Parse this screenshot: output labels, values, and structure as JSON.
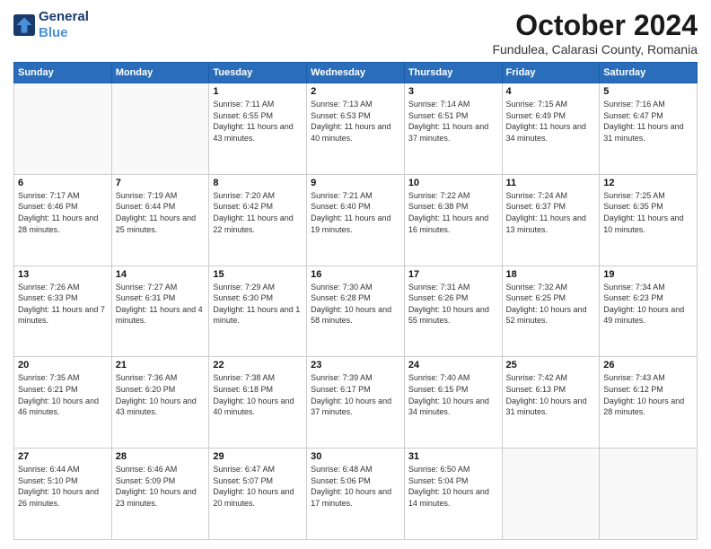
{
  "header": {
    "logo_line1": "General",
    "logo_line2": "Blue",
    "month_title": "October 2024",
    "location": "Fundulea, Calarasi County, Romania"
  },
  "days_of_week": [
    "Sunday",
    "Monday",
    "Tuesday",
    "Wednesday",
    "Thursday",
    "Friday",
    "Saturday"
  ],
  "weeks": [
    [
      {
        "day": "",
        "info": ""
      },
      {
        "day": "",
        "info": ""
      },
      {
        "day": "1",
        "info": "Sunrise: 7:11 AM\nSunset: 6:55 PM\nDaylight: 11 hours and 43 minutes."
      },
      {
        "day": "2",
        "info": "Sunrise: 7:13 AM\nSunset: 6:53 PM\nDaylight: 11 hours and 40 minutes."
      },
      {
        "day": "3",
        "info": "Sunrise: 7:14 AM\nSunset: 6:51 PM\nDaylight: 11 hours and 37 minutes."
      },
      {
        "day": "4",
        "info": "Sunrise: 7:15 AM\nSunset: 6:49 PM\nDaylight: 11 hours and 34 minutes."
      },
      {
        "day": "5",
        "info": "Sunrise: 7:16 AM\nSunset: 6:47 PM\nDaylight: 11 hours and 31 minutes."
      }
    ],
    [
      {
        "day": "6",
        "info": "Sunrise: 7:17 AM\nSunset: 6:46 PM\nDaylight: 11 hours and 28 minutes."
      },
      {
        "day": "7",
        "info": "Sunrise: 7:19 AM\nSunset: 6:44 PM\nDaylight: 11 hours and 25 minutes."
      },
      {
        "day": "8",
        "info": "Sunrise: 7:20 AM\nSunset: 6:42 PM\nDaylight: 11 hours and 22 minutes."
      },
      {
        "day": "9",
        "info": "Sunrise: 7:21 AM\nSunset: 6:40 PM\nDaylight: 11 hours and 19 minutes."
      },
      {
        "day": "10",
        "info": "Sunrise: 7:22 AM\nSunset: 6:38 PM\nDaylight: 11 hours and 16 minutes."
      },
      {
        "day": "11",
        "info": "Sunrise: 7:24 AM\nSunset: 6:37 PM\nDaylight: 11 hours and 13 minutes."
      },
      {
        "day": "12",
        "info": "Sunrise: 7:25 AM\nSunset: 6:35 PM\nDaylight: 11 hours and 10 minutes."
      }
    ],
    [
      {
        "day": "13",
        "info": "Sunrise: 7:26 AM\nSunset: 6:33 PM\nDaylight: 11 hours and 7 minutes."
      },
      {
        "day": "14",
        "info": "Sunrise: 7:27 AM\nSunset: 6:31 PM\nDaylight: 11 hours and 4 minutes."
      },
      {
        "day": "15",
        "info": "Sunrise: 7:29 AM\nSunset: 6:30 PM\nDaylight: 11 hours and 1 minute."
      },
      {
        "day": "16",
        "info": "Sunrise: 7:30 AM\nSunset: 6:28 PM\nDaylight: 10 hours and 58 minutes."
      },
      {
        "day": "17",
        "info": "Sunrise: 7:31 AM\nSunset: 6:26 PM\nDaylight: 10 hours and 55 minutes."
      },
      {
        "day": "18",
        "info": "Sunrise: 7:32 AM\nSunset: 6:25 PM\nDaylight: 10 hours and 52 minutes."
      },
      {
        "day": "19",
        "info": "Sunrise: 7:34 AM\nSunset: 6:23 PM\nDaylight: 10 hours and 49 minutes."
      }
    ],
    [
      {
        "day": "20",
        "info": "Sunrise: 7:35 AM\nSunset: 6:21 PM\nDaylight: 10 hours and 46 minutes."
      },
      {
        "day": "21",
        "info": "Sunrise: 7:36 AM\nSunset: 6:20 PM\nDaylight: 10 hours and 43 minutes."
      },
      {
        "day": "22",
        "info": "Sunrise: 7:38 AM\nSunset: 6:18 PM\nDaylight: 10 hours and 40 minutes."
      },
      {
        "day": "23",
        "info": "Sunrise: 7:39 AM\nSunset: 6:17 PM\nDaylight: 10 hours and 37 minutes."
      },
      {
        "day": "24",
        "info": "Sunrise: 7:40 AM\nSunset: 6:15 PM\nDaylight: 10 hours and 34 minutes."
      },
      {
        "day": "25",
        "info": "Sunrise: 7:42 AM\nSunset: 6:13 PM\nDaylight: 10 hours and 31 minutes."
      },
      {
        "day": "26",
        "info": "Sunrise: 7:43 AM\nSunset: 6:12 PM\nDaylight: 10 hours and 28 minutes."
      }
    ],
    [
      {
        "day": "27",
        "info": "Sunrise: 6:44 AM\nSunset: 5:10 PM\nDaylight: 10 hours and 26 minutes."
      },
      {
        "day": "28",
        "info": "Sunrise: 6:46 AM\nSunset: 5:09 PM\nDaylight: 10 hours and 23 minutes."
      },
      {
        "day": "29",
        "info": "Sunrise: 6:47 AM\nSunset: 5:07 PM\nDaylight: 10 hours and 20 minutes."
      },
      {
        "day": "30",
        "info": "Sunrise: 6:48 AM\nSunset: 5:06 PM\nDaylight: 10 hours and 17 minutes."
      },
      {
        "day": "31",
        "info": "Sunrise: 6:50 AM\nSunset: 5:04 PM\nDaylight: 10 hours and 14 minutes."
      },
      {
        "day": "",
        "info": ""
      },
      {
        "day": "",
        "info": ""
      }
    ]
  ]
}
